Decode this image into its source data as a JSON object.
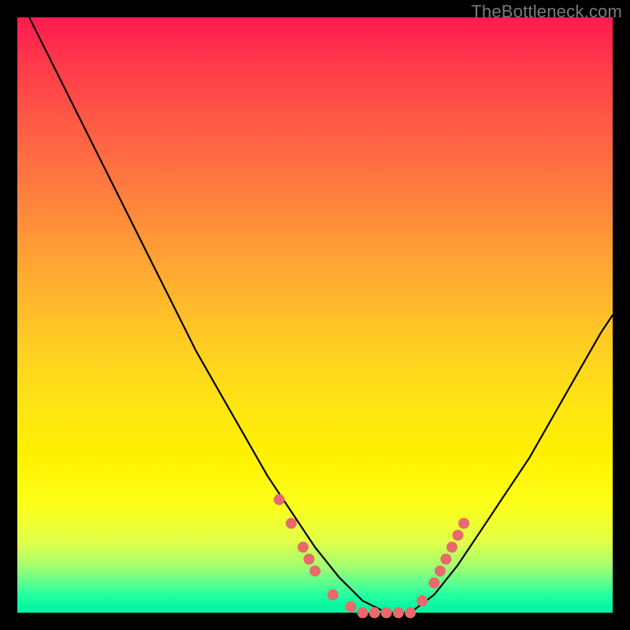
{
  "watermark": "TheBottleneck.com",
  "chart_data": {
    "type": "line",
    "title": "",
    "xlabel": "",
    "ylabel": "",
    "xlim": [
      0,
      100
    ],
    "ylim": [
      0,
      100
    ],
    "note": "Heat-map style bottleneck curve. X and Y are unlabeled percentages (0–100). Background color encodes severity (red = high bottleneck, green = balanced). The black curve shows bottleneck %, dipping to 0 around x≈56–66. Pink markers show sample points on the curve near the minimum region.",
    "series": [
      {
        "name": "bottleneck-curve",
        "x": [
          2,
          6,
          10,
          14,
          18,
          22,
          26,
          30,
          34,
          38,
          42,
          46,
          50,
          54,
          58,
          62,
          66,
          70,
          74,
          78,
          82,
          86,
          90,
          94,
          98,
          100
        ],
        "y": [
          100,
          92,
          84,
          76,
          68,
          60,
          52,
          44,
          37,
          30,
          23,
          17,
          11,
          6,
          2,
          0,
          0,
          3,
          8,
          14,
          20,
          26,
          33,
          40,
          47,
          50
        ]
      }
    ],
    "markers": {
      "name": "sample-points",
      "color": "#e86a6a",
      "points": [
        {
          "x": 44,
          "y": 19
        },
        {
          "x": 46,
          "y": 15
        },
        {
          "x": 48,
          "y": 11
        },
        {
          "x": 49,
          "y": 9
        },
        {
          "x": 50,
          "y": 7
        },
        {
          "x": 53,
          "y": 3
        },
        {
          "x": 56,
          "y": 1
        },
        {
          "x": 58,
          "y": 0
        },
        {
          "x": 60,
          "y": 0
        },
        {
          "x": 62,
          "y": 0
        },
        {
          "x": 64,
          "y": 0
        },
        {
          "x": 66,
          "y": 0
        },
        {
          "x": 68,
          "y": 2
        },
        {
          "x": 70,
          "y": 5
        },
        {
          "x": 71,
          "y": 7
        },
        {
          "x": 72,
          "y": 9
        },
        {
          "x": 73,
          "y": 11
        },
        {
          "x": 74,
          "y": 13
        },
        {
          "x": 75,
          "y": 15
        }
      ]
    }
  }
}
